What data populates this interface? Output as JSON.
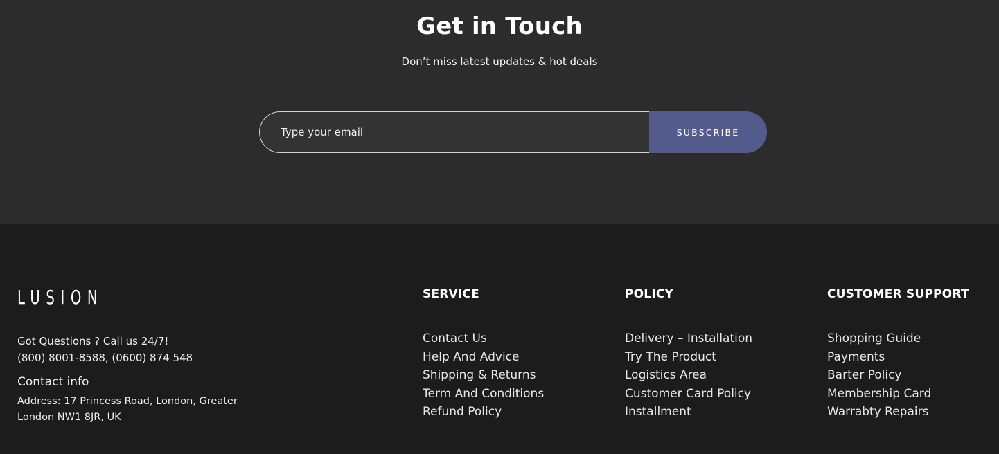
{
  "newsletter": {
    "title": "Get in Touch",
    "subtitle": "Don’t miss latest updates & hot deals",
    "email_placeholder": "Type your email",
    "subscribe_label": "SUBSCRIBE"
  },
  "footer": {
    "logo": "LUSION",
    "contact": {
      "question": "Got Questions ? Call us 24/7!",
      "phones": "(800) 8001-8588, (0600) 874 548",
      "heading": "Contact info",
      "address": "Address: 17 Princess Road, London, Greater London NW1 8JR, UK"
    },
    "columns": [
      {
        "heading": "SERVICE",
        "links": [
          "Contact Us",
          "Help And Advice",
          "Shipping & Returns",
          "Term And Conditions",
          "Refund Policy"
        ]
      },
      {
        "heading": "POLICY",
        "links": [
          "Delivery – Installation",
          "Try The Product",
          "Logistics Area",
          "Customer Card Policy",
          "Installment"
        ]
      },
      {
        "heading": "CUSTOMER SUPPORT",
        "links": [
          "Shopping Guide",
          "Payments",
          "Barter Policy",
          "Membership Card",
          "Warrabty Repairs"
        ]
      }
    ]
  },
  "colors": {
    "newsletter_bg": "#2c2c2c",
    "footer_bg": "#1c1c1c",
    "accent": "#535a8c"
  }
}
